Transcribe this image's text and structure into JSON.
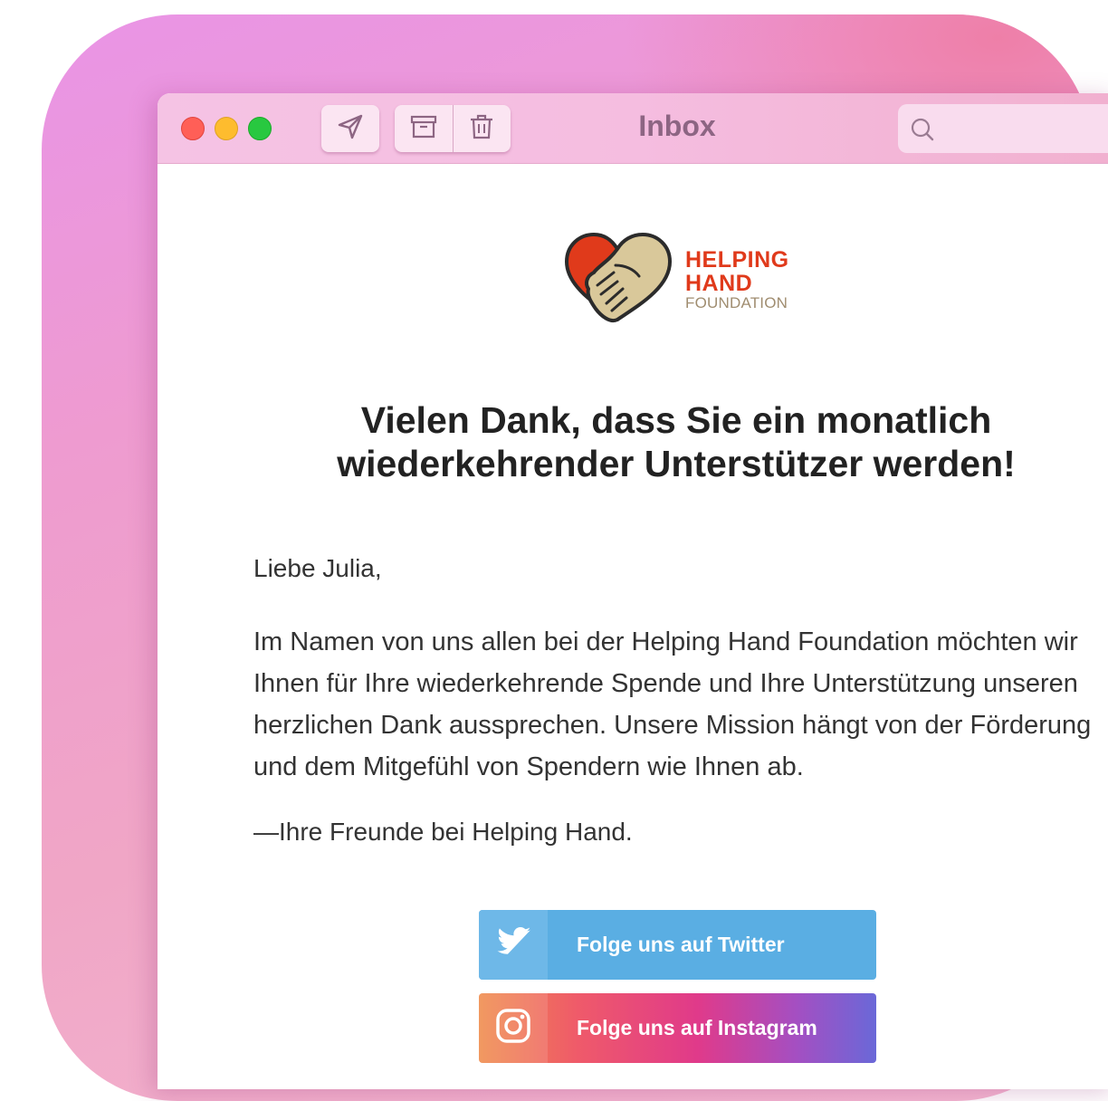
{
  "window": {
    "title": "Inbox",
    "search_placeholder": ""
  },
  "toolbar": {
    "icons": [
      "send-icon",
      "archive-icon",
      "trash-icon",
      "search-icon"
    ]
  },
  "email": {
    "logo": {
      "line1": "HELPING",
      "line2": "HAND",
      "line3": "FOUNDATION",
      "colors": {
        "red": "#e03a1b",
        "hand": "#d9c89a",
        "outline": "#2b2b2b"
      }
    },
    "headline": "Vielen Dank, dass Sie ein monatlich wiederkehrender Unterstützer werden!",
    "greeting": "Liebe Julia,",
    "body": "Im Namen von uns allen bei der Helping Hand Foundation möchten wir Ihnen für Ihre wiederkehrende Spende und Ihre Unterstützung unseren herzlichen Dank aussprechen. Unsere Mission hängt von der Förderung und dem Mitgefühl von Spendern wie Ihnen ab.",
    "signoff": "—Ihre Freunde bei Helping Hand.",
    "buttons": [
      {
        "label": "Folge uns auf Twitter",
        "icon": "twitter-icon",
        "color": "#5aaee3"
      },
      {
        "label": "Folge uns auf Instagram",
        "icon": "instagram-icon",
        "color": "#e03a8a"
      }
    ]
  }
}
